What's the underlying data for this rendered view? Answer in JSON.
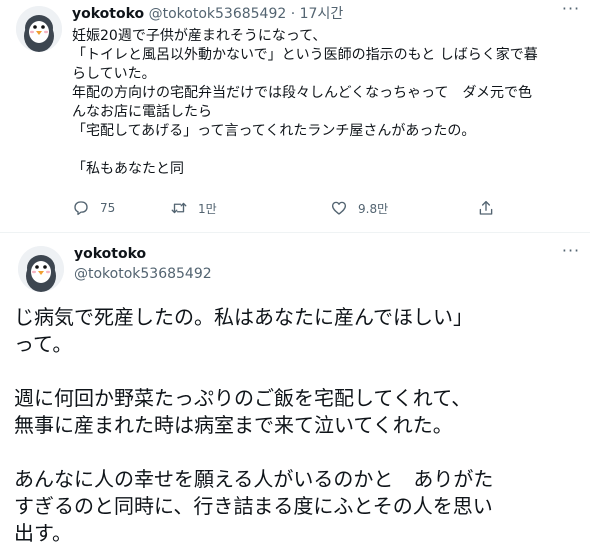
{
  "tweet1": {
    "name": "yokotoko",
    "handle": "@tokotok53685492",
    "separator": "·",
    "time": "17시간",
    "lines": [
      "妊娠20週で子供が産まれそうになって、",
      "「トイレと風呂以外動かないで」という医師の指示のもと しばらく家で暮",
      "らしていた。",
      "年配の方向けの宅配弁当だけでは段々しんどくなっちゃって　ダメ元で色",
      "んなお店に電話したら",
      "「宅配してあげる」って言ってくれたランチ屋さんがあったの。",
      "",
      "「私もあなたと同"
    ],
    "actions": {
      "reply_count": "75",
      "retweet_count": "1만",
      "like_count": "9.8만"
    },
    "icons": [
      "reply-icon",
      "retweet-icon",
      "like-icon",
      "share-icon",
      "more-icon"
    ]
  },
  "tweet2": {
    "name": "yokotoko",
    "handle": "@tokotok53685492",
    "lines": [
      "じ病気で死産したの。私はあなたに産んでほしい」",
      "って。",
      "",
      "週に何回か野菜たっぷりのご飯を宅配してくれて、",
      "無事に産まれた時は病室まで来て泣いてくれた。",
      "",
      "あんなに人の幸せを願える人がいるのかと　ありがた",
      "すぎるのと同時に、行き詰まる度にふとその人を思い",
      "出す。"
    ]
  },
  "colors": {
    "text": "#0f1419",
    "secondary": "#536471",
    "divider": "#eff3f4"
  }
}
